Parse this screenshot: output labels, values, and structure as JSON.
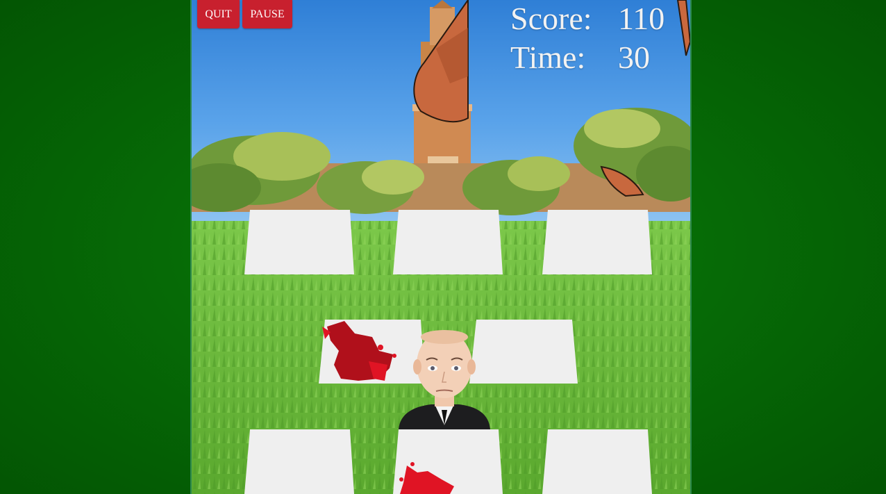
{
  "controls": {
    "quit_label": "QUIT",
    "pause_label": "PAUSE"
  },
  "hud": {
    "score_label": "Score:",
    "score_value": "110",
    "time_label": "Time:",
    "time_value": "30"
  },
  "colors": {
    "button_red": "#c8202e",
    "grass_green": "#6cbb3c",
    "table_white": "#efefef",
    "blood_red": "#d41020"
  },
  "board": {
    "rows": [
      [
        "table",
        "table",
        "table"
      ],
      [
        "table-splattered",
        "character-popup",
        "table"
      ],
      [
        "table",
        "table-splattered",
        "table"
      ]
    ]
  }
}
